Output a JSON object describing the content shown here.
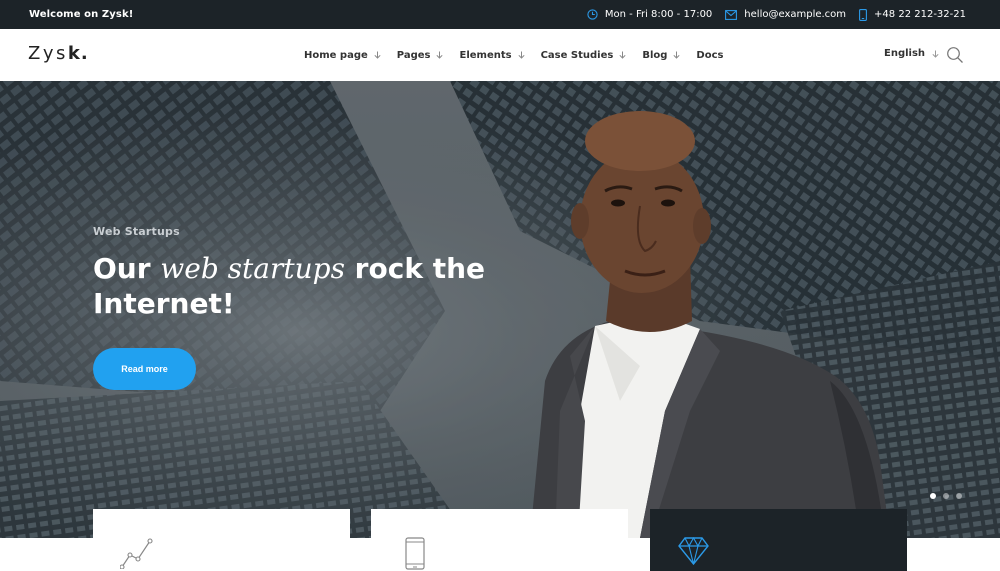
{
  "topbar": {
    "welcome": "Welcome on Zysk!",
    "hours": "Mon - Fri 8:00 - 17:00",
    "email": "hello@example.com",
    "phone": "+48 22 212-32-21",
    "icons": [
      "clock-icon",
      "mail-icon",
      "phone-icon"
    ],
    "accent_color": "#2b9ae8"
  },
  "header": {
    "logo_light": "Zys",
    "logo_bold": "k.",
    "nav": [
      {
        "label": "Home page",
        "has_dropdown": true
      },
      {
        "label": "Pages",
        "has_dropdown": true
      },
      {
        "label": "Elements",
        "has_dropdown": true
      },
      {
        "label": "Case Studies",
        "has_dropdown": true
      },
      {
        "label": "Blog",
        "has_dropdown": true
      },
      {
        "label": "Docs",
        "has_dropdown": false
      }
    ],
    "language": "English"
  },
  "hero": {
    "tag": "Web Startups",
    "title_part1": "Our ",
    "title_italic": "web startups",
    "title_part2": " rock the Internet!",
    "button": "Read more",
    "button_color": "#21a1f0",
    "slides": 3,
    "active_slide": 1
  },
  "cards": [
    {
      "icon": "growth-chart-icon",
      "theme": "light"
    },
    {
      "icon": "mobile-phone-icon",
      "theme": "light"
    },
    {
      "icon": "diamond-icon",
      "theme": "dark"
    }
  ]
}
